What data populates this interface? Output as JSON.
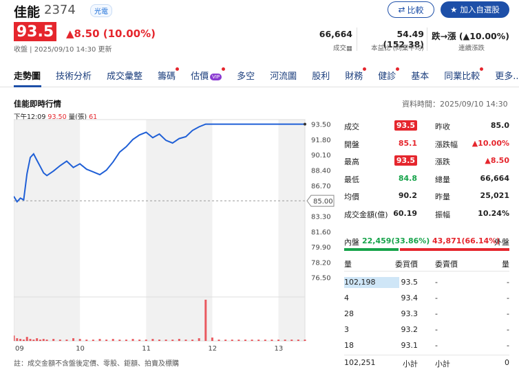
{
  "header": {
    "name": "佳能",
    "code": "2374",
    "tag": "光電",
    "compare_label": "比較",
    "watchlist_label": "加入自選股",
    "price": "93.5",
    "change": "▲8.50 (10.00%)",
    "timestamp": "收盤 | 2025/09/10 14:30 更新",
    "stats": [
      {
        "value": "66,664",
        "label": "成交▦"
      },
      {
        "value": "54.49 (152.38)",
        "label": "本益比 (同業平均)"
      },
      {
        "value": "跌→漲 (▲10.00%)",
        "label": "連續漲跌"
      }
    ]
  },
  "tabs": [
    {
      "label": "走勢圖",
      "active": true,
      "dot": false
    },
    {
      "label": "技術分析",
      "dot": false
    },
    {
      "label": "成交彙整",
      "dot": false
    },
    {
      "label": "籌碼",
      "dot": true
    },
    {
      "label": "估價",
      "dot": true,
      "vip": "VIP"
    },
    {
      "label": "多空",
      "dot": false
    },
    {
      "label": "河流圖",
      "dot": false
    },
    {
      "label": "股利",
      "dot": false
    },
    {
      "label": "財務",
      "dot": true
    },
    {
      "label": "健診",
      "dot": true
    },
    {
      "label": "基本",
      "dot": false
    },
    {
      "label": "同業比較",
      "dot": true
    },
    {
      "label": "更多...",
      "dot": true
    }
  ],
  "chart_section": {
    "title": "佳能即時行情",
    "data_time": "資料時間：2025/09/10 14:30",
    "legend_time": "下午12:09",
    "legend_price": "93.50",
    "legend_vol_label": "量(張)",
    "legend_vol": "61",
    "note": "註：成交金額不含盤後定價、零股、鉅額、拍賣及標購"
  },
  "chart_data": {
    "type": "line",
    "title": "",
    "x_ticks": [
      "09",
      "10",
      "11",
      "12",
      "13"
    ],
    "y_ticks": [
      93.5,
      91.8,
      90.1,
      88.4,
      86.7,
      85.0,
      83.3,
      81.6,
      79.9,
      78.2,
      76.5
    ],
    "ylim": [
      74.5,
      94.0
    ],
    "ref_price": 85.0,
    "ref_label": "85.00",
    "series": [
      {
        "x": [
          0.0,
          0.05,
          0.1,
          0.15,
          0.2,
          0.25,
          0.3,
          0.35,
          0.4,
          0.45,
          0.5,
          0.6,
          0.7,
          0.8,
          0.9,
          1.0,
          1.1,
          1.2,
          1.3,
          1.4,
          1.5,
          1.6,
          1.7,
          1.8,
          1.9,
          2.0,
          2.1,
          2.2,
          2.3,
          2.4,
          2.5,
          2.6,
          2.7,
          2.8,
          2.9,
          3.0,
          3.1,
          3.2,
          3.3,
          3.4,
          3.5,
          3.6,
          3.7,
          3.8,
          3.9,
          4.0,
          4.1,
          4.2,
          4.3,
          4.4
        ],
        "y": [
          85.5,
          84.9,
          85.3,
          85.1,
          88.0,
          89.8,
          90.2,
          89.5,
          88.8,
          88.1,
          87.8,
          88.3,
          88.9,
          89.4,
          88.7,
          89.1,
          88.5,
          88.2,
          87.9,
          88.4,
          89.3,
          90.4,
          91.0,
          91.8,
          92.3,
          92.6,
          92.0,
          92.4,
          91.7,
          91.4,
          91.9,
          92.1,
          92.8,
          93.2,
          93.5,
          93.5,
          93.5,
          93.5,
          93.5,
          93.5,
          93.5,
          93.5,
          93.5,
          93.5,
          93.5,
          93.5,
          93.5,
          93.5,
          93.5,
          93.5
        ]
      }
    ],
    "volume": [
      8,
      4,
      3,
      2,
      6,
      3,
      2,
      4,
      2,
      3,
      2,
      3,
      2,
      2,
      4,
      3,
      2,
      2,
      3,
      2,
      3,
      2,
      2,
      3,
      2,
      2,
      3,
      2,
      2,
      2,
      3,
      2,
      2,
      4,
      61,
      5,
      2,
      2,
      2,
      2,
      2,
      2,
      2,
      2,
      2,
      2,
      2,
      2,
      2,
      2
    ],
    "colors": {
      "line": "#1f5fd6",
      "ref": "#999999",
      "volume": "#e5262d",
      "shade": "#f1f1f1"
    }
  },
  "quote": {
    "left": [
      {
        "label": "成交",
        "value": "93.5",
        "style": "pill"
      },
      {
        "label": "開盤",
        "value": "85.1",
        "style": "red"
      },
      {
        "label": "最高",
        "value": "93.5",
        "style": "pill"
      },
      {
        "label": "最低",
        "value": "84.8",
        "style": "green"
      },
      {
        "label": "均價",
        "value": "90.2",
        "style": "plain"
      },
      {
        "label": "成交金額(億)",
        "value": "60.19",
        "style": "plain"
      }
    ],
    "right": [
      {
        "label": "昨收",
        "value": "85.0",
        "style": "plain"
      },
      {
        "label": "漲跌幅",
        "value": "▲10.00%",
        "style": "red"
      },
      {
        "label": "漲跌",
        "value": "▲8.50",
        "style": "red"
      },
      {
        "label": "總量",
        "value": "66,664",
        "style": "plain"
      },
      {
        "label": "昨量",
        "value": "25,021",
        "style": "plain"
      },
      {
        "label": "振幅",
        "value": "10.24%",
        "style": "plain"
      }
    ]
  },
  "inout": {
    "in_label": "內盤",
    "in_value": "22,459(33.86%)",
    "out_value": "43,871(66.14%)",
    "out_label": "外盤",
    "in_fraction": 0.3386
  },
  "orderbook": {
    "headers": [
      "量",
      "委買價",
      "委賣價",
      "量"
    ],
    "rows": [
      {
        "bid_vol": "102,198",
        "bid": "93.5",
        "ask": "-",
        "ask_vol": "-",
        "highlight": true
      },
      {
        "bid_vol": "4",
        "bid": "93.4",
        "ask": "-",
        "ask_vol": "-"
      },
      {
        "bid_vol": "28",
        "bid": "93.3",
        "ask": "-",
        "ask_vol": "-"
      },
      {
        "bid_vol": "3",
        "bid": "93.2",
        "ask": "-",
        "ask_vol": "-"
      },
      {
        "bid_vol": "18",
        "bid": "93.1",
        "ask": "-",
        "ask_vol": "-"
      }
    ],
    "total_bid": "102,251",
    "subtotal_label": "小計",
    "subtotal_label2": "小計",
    "total_ask": "0"
  }
}
